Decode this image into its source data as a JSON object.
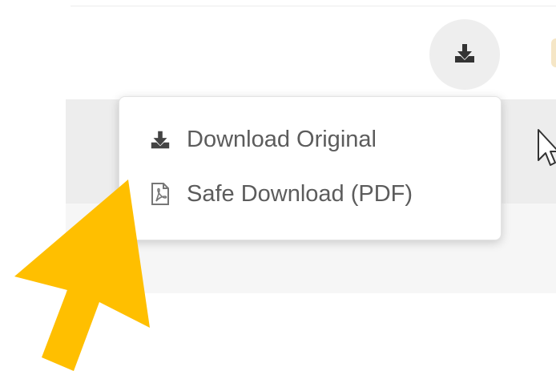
{
  "download_menu": {
    "items": [
      {
        "label": "Download Original",
        "icon": "download-icon"
      },
      {
        "label": "Safe Download (PDF)",
        "icon": "pdf-file-icon"
      }
    ]
  },
  "colors": {
    "arrow": "#FFBF00",
    "menu_text": "#5c5c5c",
    "icon": "#3a3a3a"
  }
}
